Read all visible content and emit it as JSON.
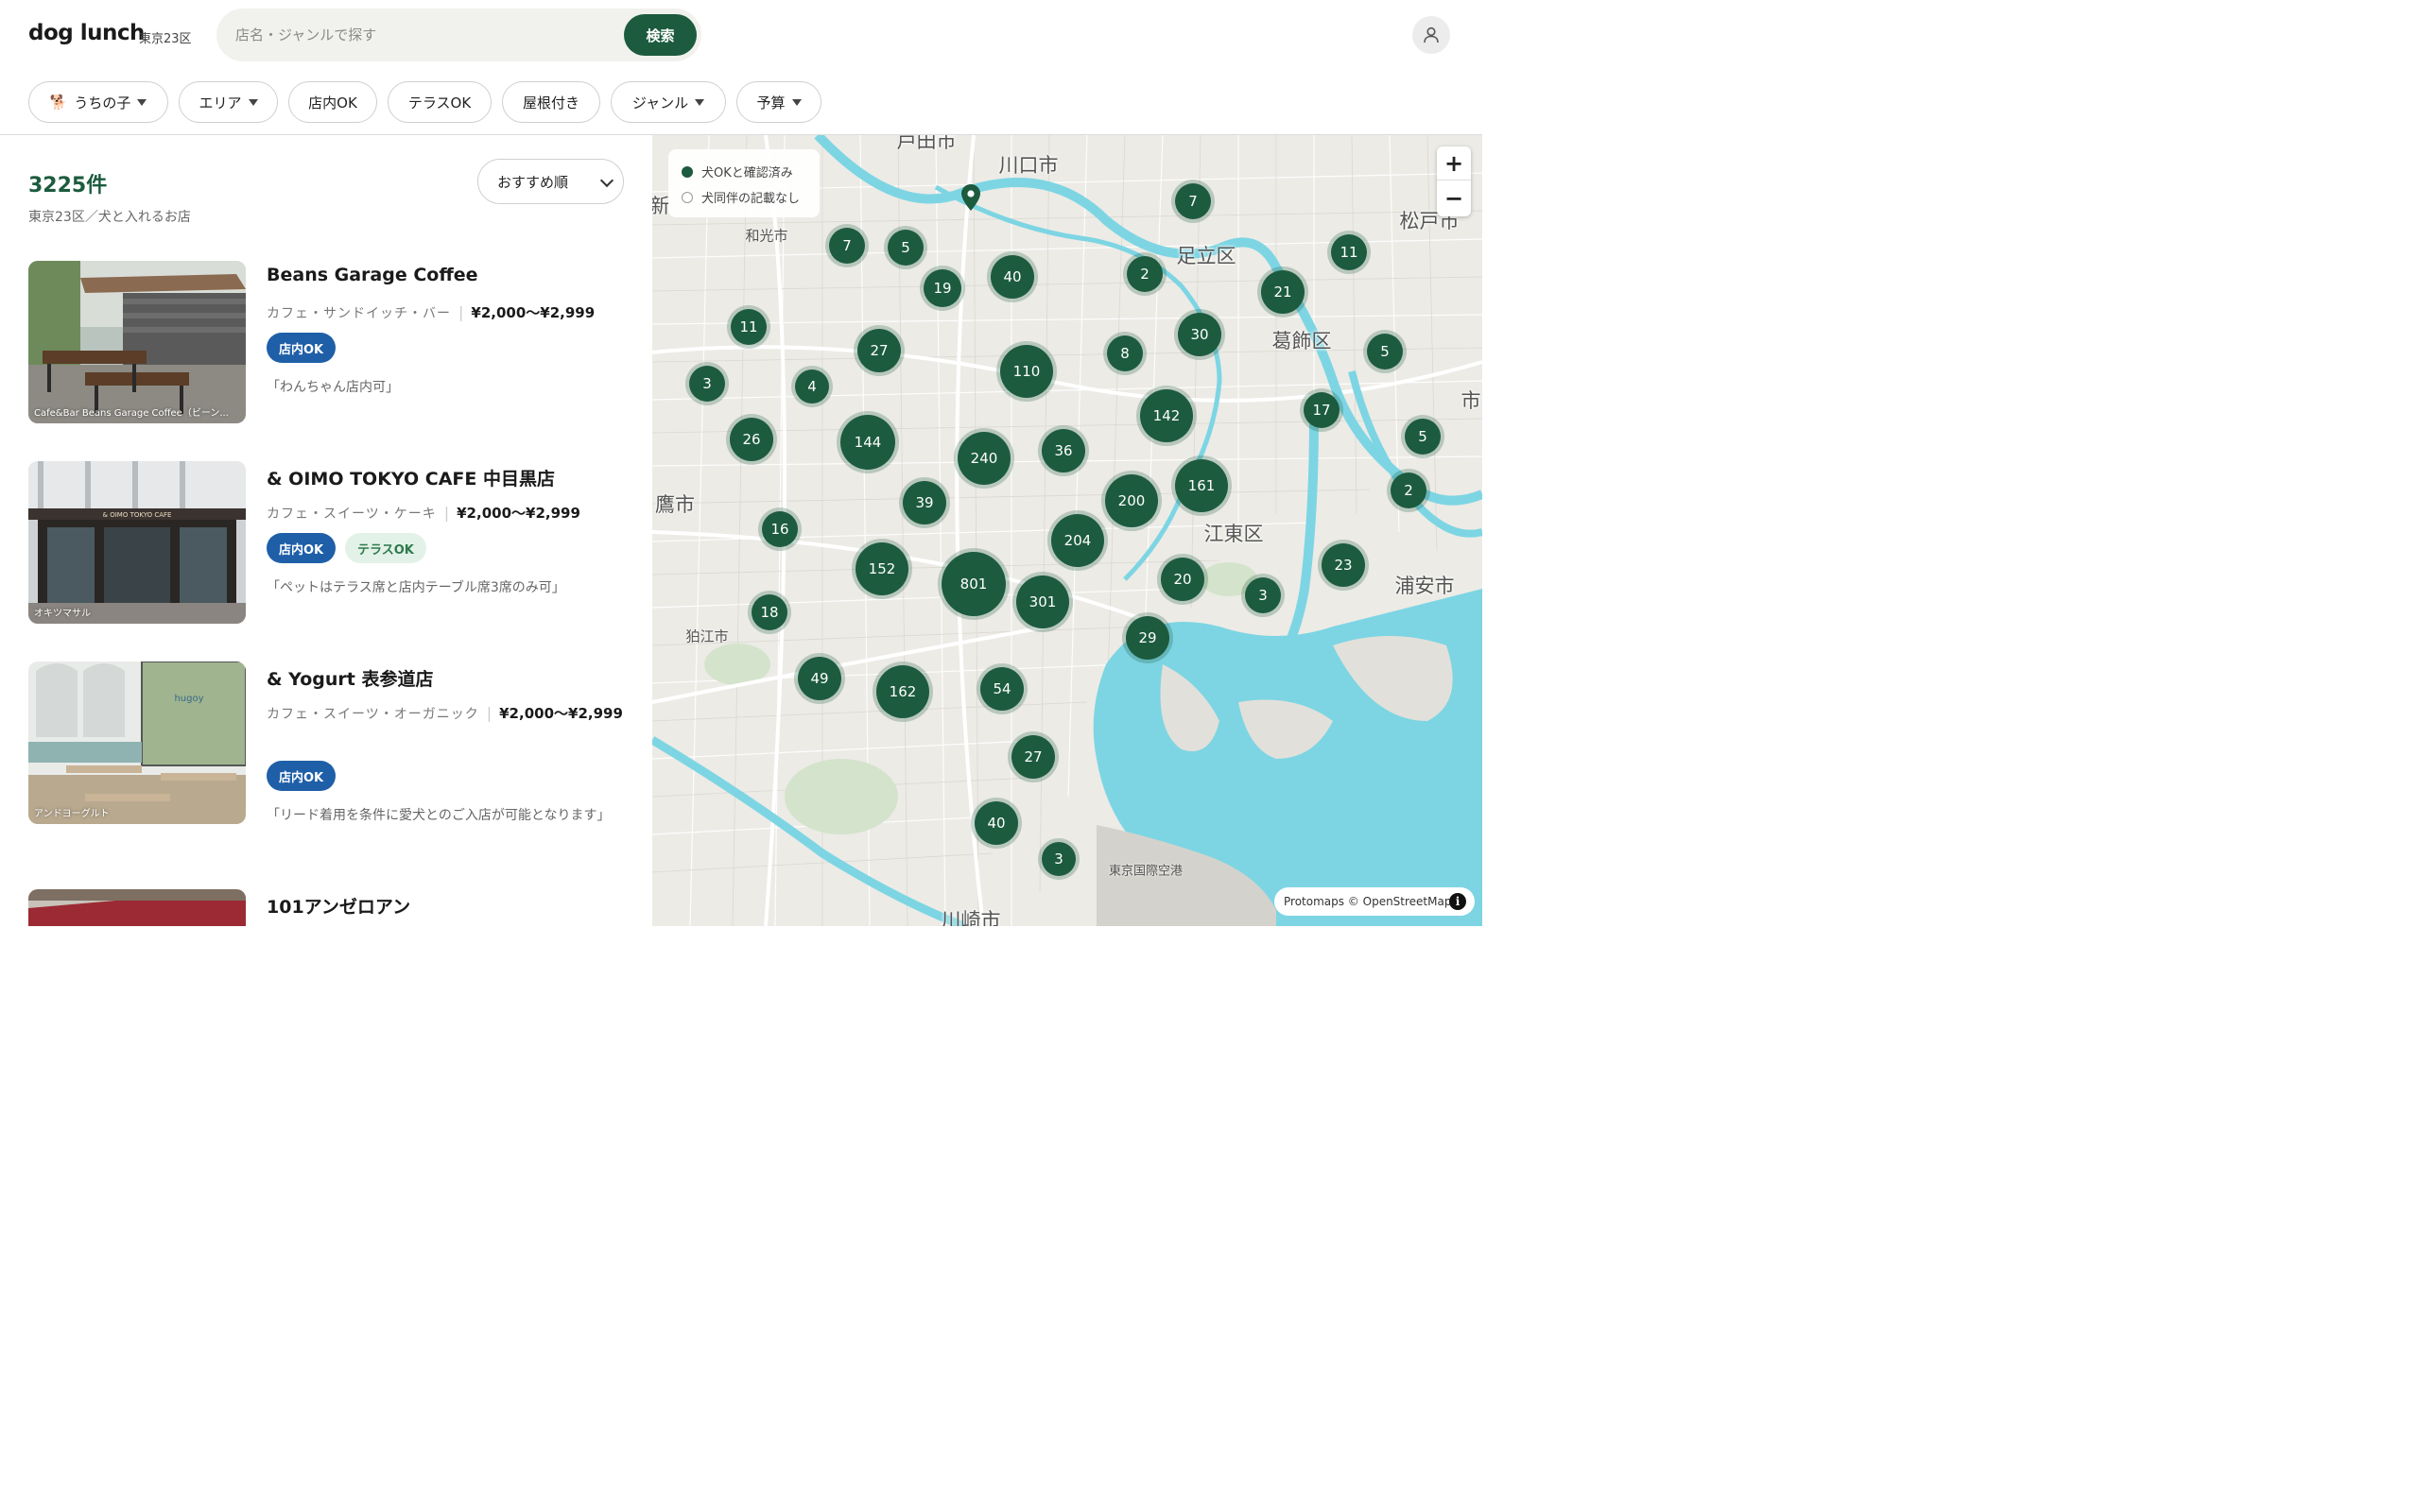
{
  "header": {
    "logo": "dog lunch",
    "area": "東京23区",
    "search_placeholder": "店名・ジャンルで探す",
    "search_button": "検索"
  },
  "filters": [
    {
      "label": "うちの子",
      "icon": "dog-emoji",
      "dropdown": true
    },
    {
      "label": "エリア",
      "dropdown": true
    },
    {
      "label": "店内OK",
      "dropdown": false
    },
    {
      "label": "テラスOK",
      "dropdown": false
    },
    {
      "label": "屋根付き",
      "dropdown": false
    },
    {
      "label": "ジャンル",
      "dropdown": true
    },
    {
      "label": "予算",
      "dropdown": true
    }
  ],
  "list": {
    "count": "3225件",
    "subtitle": "東京23区／犬と入れるお店",
    "sort": "おすすめ順",
    "items": [
      {
        "name": "Beans Garage Coffee",
        "genre": "カフェ・サンドイッチ・バー",
        "price": "¥2,000〜¥2,999",
        "badges": [
          "店内OK"
        ],
        "quote": "「わんちゃん店内可」",
        "photo_caption": "Cafe&Bar Beans Garage Coffee（ビーン..."
      },
      {
        "name": "& OIMO TOKYO CAFE 中目黒店",
        "genre": "カフェ・スイーツ・ケーキ",
        "price": "¥2,000〜¥2,999",
        "badges": [
          "店内OK",
          "テラスOK"
        ],
        "quote": "「ペットはテラス席と店内テーブル席3席のみ可」",
        "photo_caption": "オキツマサル"
      },
      {
        "name": "& Yogurt 表参道店",
        "genre": "カフェ・スイーツ・オーガニック",
        "price": "¥2,000〜¥2,999",
        "badges": [
          "店内OK"
        ],
        "quote": "「リード着用を条件に愛犬とのご入店が可能となります」",
        "photo_caption": "アンドヨーグルト"
      },
      {
        "name": "101アンゼロアン"
      }
    ]
  },
  "map": {
    "legend_confirmed": "犬OKと確認済み",
    "legend_unlisted": "犬同伴の記載なし",
    "attribution": "Protomaps © OpenStreetMap",
    "zoom_in": "+",
    "zoom_out": "−",
    "place_labels": [
      "戸田市",
      "川口市",
      "和光市",
      "足立区",
      "葛飾区",
      "松戸市",
      "鷹市",
      "江東区",
      "浦安市",
      "狛江市",
      "川崎市",
      "東京国際空港",
      "新",
      "市"
    ],
    "clusters": [
      "7",
      "7",
      "5",
      "40",
      "2",
      "11",
      "19",
      "21",
      "11",
      "27",
      "110",
      "8",
      "30",
      "5",
      "3",
      "4",
      "142",
      "17",
      "26",
      "144",
      "240",
      "36",
      "5",
      "161",
      "39",
      "200",
      "2",
      "16",
      "204",
      "152",
      "801",
      "301",
      "20",
      "3",
      "23",
      "18",
      "29",
      "49",
      "162",
      "54",
      "27",
      "40",
      "3"
    ]
  }
}
